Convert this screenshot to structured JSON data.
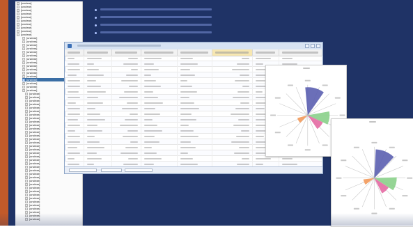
{
  "screen": {
    "title": "",
    "theme": {
      "frame": "#c25a2a",
      "desktop": "#1f3366",
      "selection": "#3a6ea5"
    }
  },
  "tree": {
    "items": [
      {
        "label": "[unclear]"
      },
      {
        "label": "[unclear]"
      },
      {
        "label": "[unclear]"
      },
      {
        "label": "[unclear]"
      },
      {
        "label": "[unclear]"
      },
      {
        "label": "[unclear]"
      },
      {
        "label": "[unclear]"
      },
      {
        "label": "[unclear]"
      },
      {
        "label": "[unclear]"
      },
      {
        "label": "[unclear]"
      },
      {
        "label": "[unclear]"
      },
      {
        "label": "[unclear]"
      },
      {
        "label": "[unclear]"
      },
      {
        "label": "[unclear]"
      },
      {
        "label": "[unclear]"
      },
      {
        "label": "[unclear]"
      },
      {
        "label": "[unclear]"
      },
      {
        "label": "[unclear]"
      },
      {
        "label": "[unclear]"
      },
      {
        "label": "[unclear]"
      },
      {
        "label": "[unclear]"
      },
      {
        "label": "[unclear]"
      },
      {
        "label": "[unclear]",
        "selected": true
      },
      {
        "label": "[unclear]"
      },
      {
        "label": "[unclear]"
      },
      {
        "label": "[unclear]"
      },
      {
        "label": "[unclear]"
      },
      {
        "label": "[unclear]"
      },
      {
        "label": "[unclear]"
      },
      {
        "label": "[unclear]"
      },
      {
        "label": "[unclear]"
      },
      {
        "label": "[unclear]"
      },
      {
        "label": "[unclear]"
      },
      {
        "label": "[unclear]"
      },
      {
        "label": "[unclear]"
      },
      {
        "label": "[unclear]"
      },
      {
        "label": "[unclear]"
      },
      {
        "label": "[unclear]"
      },
      {
        "label": "[unclear]"
      },
      {
        "label": "[unclear]"
      },
      {
        "label": "[unclear]"
      },
      {
        "label": "[unclear]"
      },
      {
        "label": "[unclear]"
      },
      {
        "label": "[unclear]"
      },
      {
        "label": "[unclear]"
      },
      {
        "label": "[unclear]"
      },
      {
        "label": "[unclear]"
      },
      {
        "label": "[unclear]"
      },
      {
        "label": "[unclear]"
      },
      {
        "label": "[unclear]"
      },
      {
        "label": "[unclear]"
      },
      {
        "label": "[unclear]"
      },
      {
        "label": "[unclear]"
      },
      {
        "label": "[unclear]"
      },
      {
        "label": "[unclear]"
      },
      {
        "label": "[unclear]"
      },
      {
        "label": "[unclear]"
      },
      {
        "label": "[unclear]"
      },
      {
        "label": "[unclear]"
      },
      {
        "label": "[unclear]"
      },
      {
        "label": "[unclear]"
      },
      {
        "label": "[unclear]"
      },
      {
        "label": "[unclear]"
      }
    ]
  },
  "bullets": [
    {
      "label": "[unclear]"
    },
    {
      "label": "[unclear]"
    },
    {
      "label": "[unclear]"
    },
    {
      "label": "[unclear]"
    }
  ],
  "grid_window": {
    "title": "[unclear]",
    "columns": [
      {
        "label": "[unclear]"
      },
      {
        "label": "[unclear]"
      },
      {
        "label": "[unclear]"
      },
      {
        "label": "[unclear]"
      },
      {
        "label": "[unclear]"
      },
      {
        "label": "[unclear]",
        "highlighted": true
      },
      {
        "label": "[unclear]"
      },
      {
        "label": "[unclear]"
      }
    ],
    "rows_count": 20
  },
  "rose_charts": [
    {
      "title": "[unclear]",
      "accent_colors": [
        "#5b5fb0",
        "#8ad08a",
        "#e46aa3",
        "#f39a5b"
      ]
    },
    {
      "title": "[unclear]",
      "accent_colors": [
        "#5b5fb0",
        "#8ad08a",
        "#e46aa3",
        "#f39a5b"
      ]
    }
  ]
}
